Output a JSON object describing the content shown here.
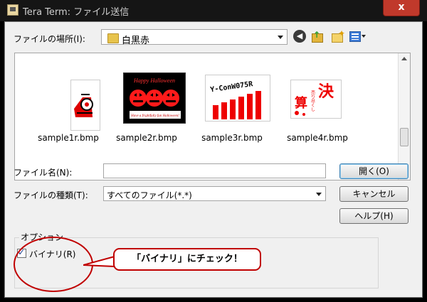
{
  "window": {
    "title": "Tera Term: ファイル送信",
    "close_label": "x"
  },
  "location": {
    "label": "ファイルの場所(I):",
    "value": "白黒赤"
  },
  "toolbar": {
    "icons": [
      "back-icon",
      "up-folder-icon",
      "new-folder-icon",
      "view-menu-icon"
    ]
  },
  "files": [
    {
      "name": "sample1r.bmp"
    },
    {
      "name": "sample2r.bmp",
      "thumb_text_top": "Happy Halloween",
      "thumb_text_bottom": "Have a frightfully fun Halloween!"
    },
    {
      "name": "sample3r.bmp",
      "thumb_text": "Y-ConW075R"
    },
    {
      "name": "sample4r.bmp",
      "thumb_kanji_main": "決",
      "thumb_kanji_sub": "算",
      "thumb_text_side": "売り尽くし"
    }
  ],
  "filename": {
    "label": "ファイル名(N):",
    "value": ""
  },
  "filetype": {
    "label": "ファイルの種類(T):",
    "value": "すべてのファイル(*.*)"
  },
  "buttons": {
    "open": "開く(O)",
    "cancel": "キャンセル",
    "help": "ヘルプ(H)"
  },
  "options": {
    "group_label": "オプション",
    "binary_label": "バイナリ(R)",
    "binary_checked": true
  },
  "annotation": {
    "text": "「バイナリ」にチェック！",
    "color": "#c00000"
  }
}
